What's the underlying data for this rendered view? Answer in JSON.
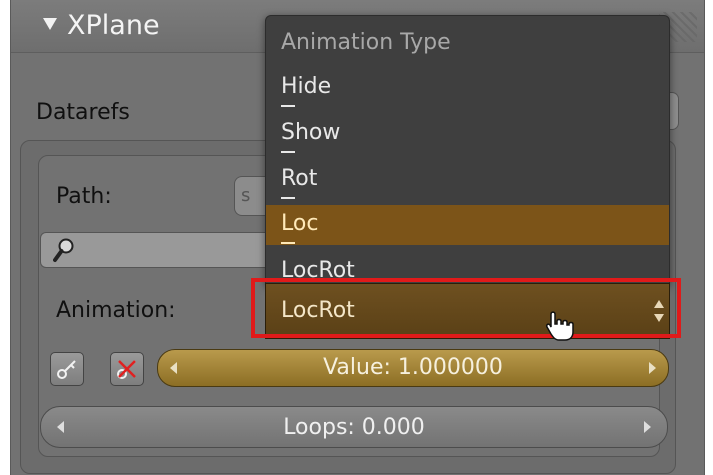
{
  "panel": {
    "title": "XPlane"
  },
  "datarefs": {
    "label": "Datarefs"
  },
  "path": {
    "label": "Path:",
    "field_prefix": "s"
  },
  "animation": {
    "label": "Animation:",
    "selected_value": "LocRot",
    "dropdown": {
      "title": "Animation Type",
      "items": [
        {
          "label": "Hide"
        },
        {
          "label": "Show"
        },
        {
          "label": "Rot"
        },
        {
          "label": "Loc",
          "highlighted": true
        },
        {
          "label": "LocRot"
        }
      ]
    }
  },
  "value_slider": {
    "text": "Value: 1.000000"
  },
  "loops_slider": {
    "text": "Loops: 0.000"
  },
  "icons": {
    "collapse": "triangle-down-icon",
    "search": "magnifier-icon",
    "keyframe": "key-icon",
    "remove_keyframe": "key-remove-icon",
    "cursor": "hand-pointer-icon"
  },
  "colors": {
    "panel_bg": "#727272",
    "menu_bg": "#3f3f3f",
    "menu_highlight": "#7c5418",
    "select_bg": "#6e5020",
    "slider_gold": "#b99a4c",
    "annotation_red": "#e01a1a"
  }
}
